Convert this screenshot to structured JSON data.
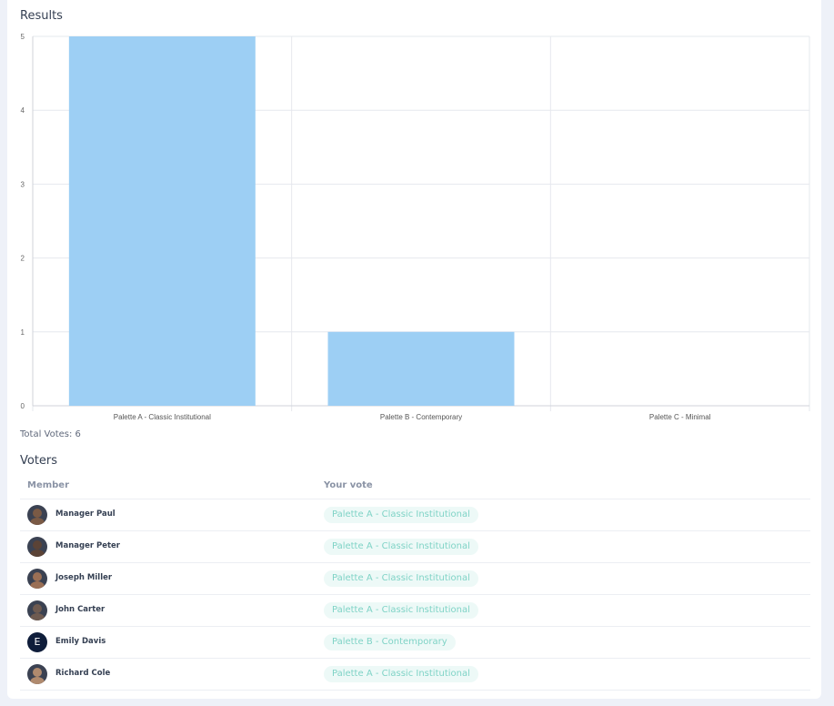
{
  "results": {
    "title": "Results",
    "total_votes": "Total Votes: 6"
  },
  "chart_data": {
    "type": "bar",
    "categories": [
      "Palette A - Classic Institutional",
      "Palette B - Contemporary",
      "Palette C - Minimal"
    ],
    "values": [
      5,
      1,
      0
    ],
    "ylim": [
      0,
      5
    ],
    "yticks": [
      0,
      1,
      2,
      3,
      4,
      5
    ],
    "grid": true,
    "bar_color": "#9dcff4",
    "title": "",
    "xlabel": "",
    "ylabel": ""
  },
  "voters": {
    "title": "Voters",
    "columns": {
      "member": "Member",
      "vote": "Your vote"
    },
    "rows": [
      {
        "name": "Manager Paul",
        "vote": "Palette A - Classic Institutional",
        "avatar": "photo"
      },
      {
        "name": "Manager Peter",
        "vote": "Palette A - Classic Institutional",
        "avatar": "photo"
      },
      {
        "name": "Joseph Miller",
        "vote": "Palette A - Classic Institutional",
        "avatar": "photo"
      },
      {
        "name": "John Carter",
        "vote": "Palette A - Classic Institutional",
        "avatar": "photo"
      },
      {
        "name": "Emily Davis",
        "vote": "Palette B - Contemporary",
        "avatar": "E"
      },
      {
        "name": "Richard Cole",
        "vote": "Palette A - Classic Institutional",
        "avatar": "photo"
      }
    ]
  }
}
